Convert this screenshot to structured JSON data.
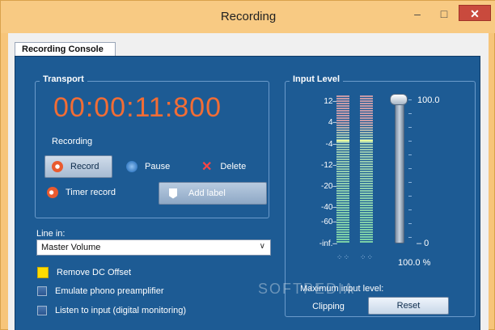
{
  "window": {
    "title": "Recording",
    "minimize": "–",
    "maximize": "□",
    "close": "✕"
  },
  "console": {
    "tab": "Recording Console"
  },
  "transport": {
    "title": "Transport",
    "timer": "00:00:11:800",
    "status": "Recording",
    "buttons": {
      "record": "Record",
      "pause": "Pause",
      "delete": "Delete",
      "timer_record": "Timer record",
      "add_label": "Add label"
    }
  },
  "line_in": {
    "label": "Line in:",
    "selected": "Master Volume"
  },
  "options": {
    "remove_dc": {
      "label": "Remove DC Offset",
      "checked": true
    },
    "emulate_phono": {
      "label": "Emulate phono preamplifier",
      "checked": false
    },
    "listen_input": {
      "label": "Listen to input (digital monitoring)",
      "checked": false
    }
  },
  "input_level": {
    "title": "Input Level",
    "scale": [
      "12–",
      "4–",
      "-4–",
      "-12–",
      "-20–",
      "-40–",
      "-60–",
      "-inf.–"
    ],
    "slider_max": "100.0",
    "slider_min": "– 0",
    "percent": "100.0 %",
    "max_label": "Maximum input level:",
    "clipping": "Clipping",
    "reset": "Reset"
  },
  "watermark": "SOFTPEDIA",
  "colors": {
    "panel": "#1d5b94",
    "timer": "#f26d35",
    "title_bar": "#f8ca83",
    "close": "#c94a3d"
  }
}
